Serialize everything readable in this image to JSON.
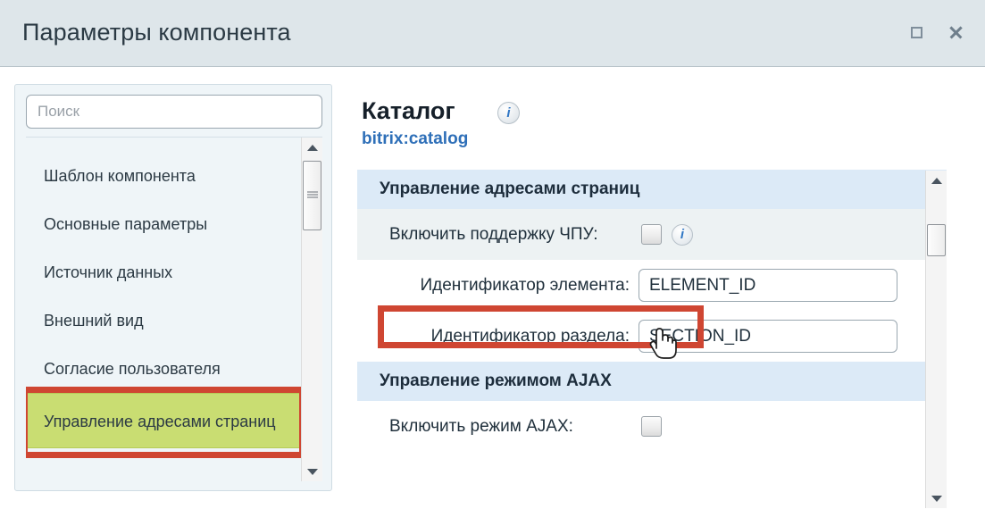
{
  "window": {
    "title": "Параметры компонента",
    "buttons": [
      {
        "name": "maximize",
        "icon": "square-icon"
      },
      {
        "name": "close",
        "icon": "close-icon"
      }
    ]
  },
  "sidebar": {
    "search": {
      "placeholder": "Поиск",
      "value": ""
    },
    "items": [
      {
        "label": "Шаблон компонента",
        "selected": false
      },
      {
        "label": "Основные параметры",
        "selected": false
      },
      {
        "label": "Источник данных",
        "selected": false
      },
      {
        "label": "Внешний вид",
        "selected": false
      },
      {
        "label": "Согласие пользователя",
        "selected": false
      },
      {
        "label": "Управление адресами страниц",
        "selected": true
      }
    ]
  },
  "component": {
    "title": "Каталог",
    "name": "bitrix:catalog",
    "info_icon": "i"
  },
  "sections": [
    {
      "header": "Управление адресами страниц",
      "rows": [
        {
          "type": "checkbox",
          "label": "Включить поддержку ЧПУ:",
          "checked": false,
          "has_info": true,
          "info_icon": "i",
          "highlighted": true
        },
        {
          "type": "input",
          "label": "Идентификатор элемента:",
          "value": "ELEMENT_ID"
        },
        {
          "type": "input",
          "label": "Идентификатор раздела:",
          "value": "SECTION_ID"
        }
      ]
    },
    {
      "header": "Управление режимом AJAX",
      "rows": [
        {
          "type": "checkbox",
          "label": "Включить режим AJAX:",
          "checked": false,
          "has_info": false
        }
      ]
    }
  ],
  "annotations": {
    "color": "#cf4632",
    "targets": [
      "sidebar-selected-item",
      "chpu-checkbox-row"
    ]
  },
  "colors": {
    "titlebar": "#dee6ea",
    "sidebar_bg": "#eff5f8",
    "selected_item": "#c9dd72",
    "section_header": "#dceaf7",
    "row_stripe": "#edf2f3",
    "link": "#2e6fb8",
    "annotation_red": "#cf4632"
  }
}
